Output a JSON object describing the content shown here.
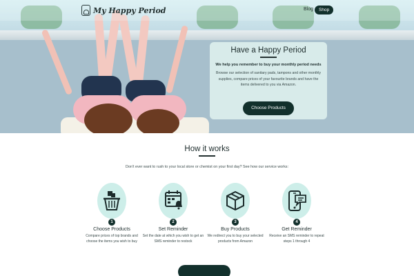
{
  "brand": {
    "name": "My Happy Period",
    "logo_icon": "calendar-drop-icon"
  },
  "nav": {
    "blog_label": "Blog",
    "shop_label": "Shop"
  },
  "hero": {
    "title": "Have a Happy Period",
    "subtitle": "We help you remember to buy your monthly period needs",
    "description": "Browse our selection of sanitary pads, tampons and other monthly supplies, compare prices of your favourite brands and have the items delivered to you via Amazon.",
    "cta_label": "Choose Products"
  },
  "how_it_works": {
    "title": "How it works",
    "subtitle": "Don't ever want to rush to your local store or chemist on your first day? See how our service works:",
    "steps": [
      {
        "number": "1",
        "title": "Choose Products",
        "description": "Compare prices of top brands and choose the items you wish to buy",
        "icon": "shopping-basket-icon"
      },
      {
        "number": "2",
        "title": "Set Reminder",
        "description": "Set the date at which you wish to get an SMS reminder to restock",
        "icon": "calendar-bell-icon"
      },
      {
        "number": "3",
        "title": "Buy Products",
        "description": "We redirect you to buy your selected products from Amazon",
        "icon": "package-box-icon"
      },
      {
        "number": "4",
        "title": "Get Reminder",
        "description": "Receive an SMS reminder to repeat steps 1 through 4",
        "icon": "phone-message-icon"
      }
    ]
  },
  "colors": {
    "primary": "#12302c",
    "accent": "#cdeee9",
    "card": "#dbeeec"
  }
}
